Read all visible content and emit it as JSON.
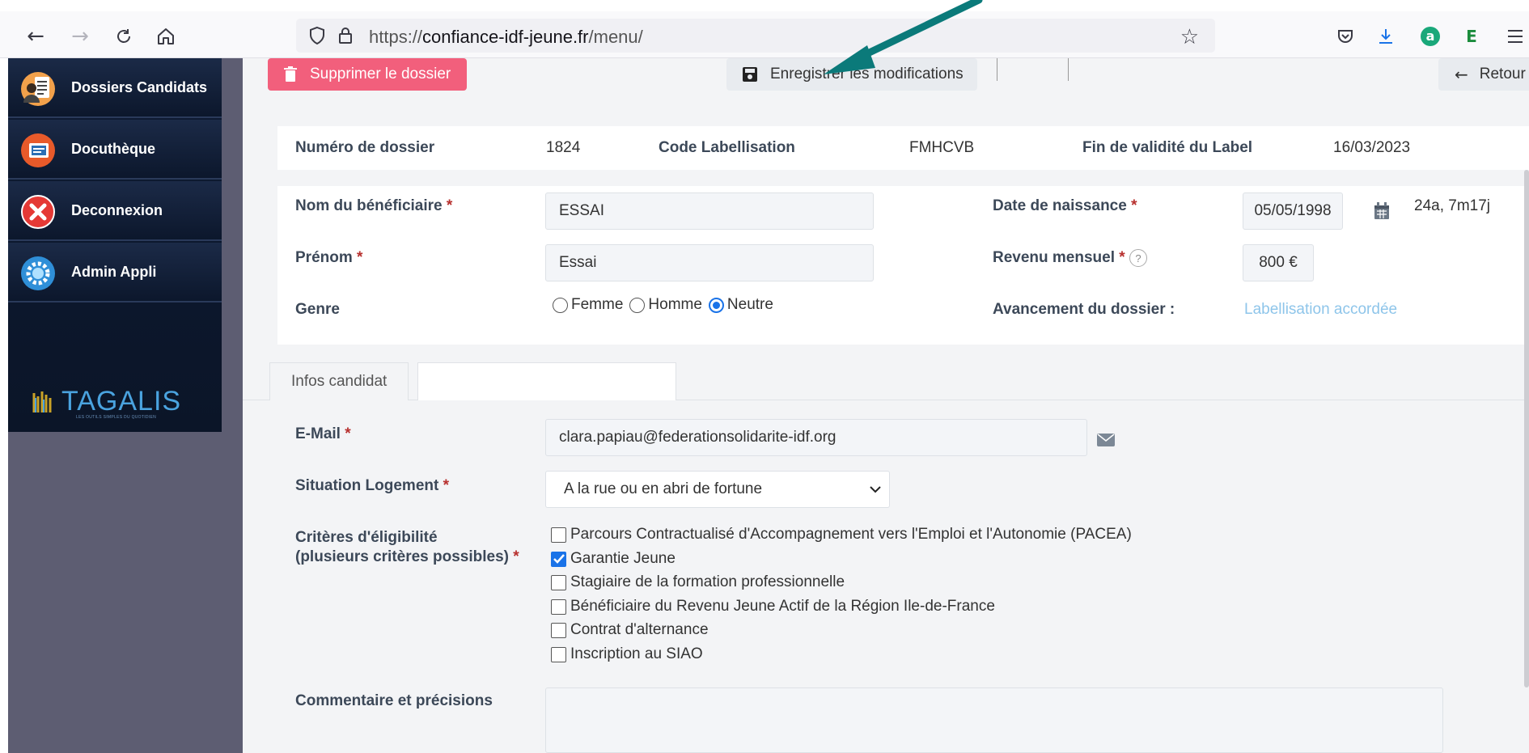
{
  "browser": {
    "url_scheme": "https://",
    "url_host": "confiance-idf-jeune.fr",
    "url_path": "/menu/"
  },
  "sidebar": {
    "items": [
      {
        "label": "Dossiers Candidats",
        "icon": "clipboard-user-icon"
      },
      {
        "label": "Docuthèque",
        "icon": "document-library-icon"
      },
      {
        "label": "Deconnexion",
        "icon": "logout-x-icon"
      },
      {
        "label": "Admin Appli",
        "icon": "gear-icon"
      }
    ],
    "logo_text": "TAGALIS",
    "logo_tagline": "LES OUTILS SIMPLES DU QUOTIDIEN"
  },
  "actions": {
    "delete_label": "Supprimer le dossier",
    "save_label": "Enregistrer les modifications",
    "back_label": "Retour"
  },
  "summary": {
    "dossier_label": "Numéro de dossier",
    "dossier_value": "1824",
    "code_label": "Code Labellisation",
    "code_value": "FMHCVB",
    "validity_label": "Fin de validité du Label",
    "validity_value": "16/03/2023"
  },
  "identity": {
    "nom_label": "Nom du bénéficiaire",
    "nom_value": "ESSAI",
    "prenom_label": "Prénom",
    "prenom_value": "Essai",
    "genre_label": "Genre",
    "genre_options": [
      "Femme",
      "Homme",
      "Neutre"
    ],
    "genre_selected": "Neutre",
    "dob_label": "Date de naissance",
    "dob_value": "05/05/1998",
    "age_value": "24a, 7m17j",
    "revenu_label": "Revenu mensuel",
    "revenu_value": "800 €",
    "avancement_label": "Avancement du dossier :",
    "avancement_value": "Labellisation accordée",
    "required_mark": "*",
    "help_mark": "?"
  },
  "tabs": [
    {
      "label": "Infos candidat"
    },
    {
      "label": ""
    }
  ],
  "details": {
    "email_label": "E-Mail",
    "email_value": "clara.papiau@federationsolidarite-idf.org",
    "logement_label": "Situation Logement",
    "logement_value": "A la rue ou en abri de fortune",
    "criteres_label_1": "Critères d'éligibilité",
    "criteres_label_2": "(plusieurs critères possibles)",
    "criteres": [
      {
        "label": "Parcours Contractualisé d'Accompagnement vers l'Emploi et l'Autonomie (PACEA)",
        "checked": false
      },
      {
        "label": "Garantie Jeune",
        "checked": true
      },
      {
        "label": "Stagiaire de la formation professionnelle",
        "checked": false
      },
      {
        "label": "Bénéficiaire du Revenu Jeune Actif de la Région Ile-de-France",
        "checked": false
      },
      {
        "label": "Contrat d'alternance",
        "checked": false
      },
      {
        "label": "Inscription au SIAO",
        "checked": false
      }
    ],
    "commentaire_label": "Commentaire et précisions",
    "commentaire_value": ""
  },
  "colors": {
    "accent_blue": "#1a73e8",
    "delete_pink": "#f25f7c",
    "sidebar_navy": "#0e1b33",
    "annotation_arrow": "#0b7a7a",
    "status_light_blue": "#8ec5ea"
  }
}
